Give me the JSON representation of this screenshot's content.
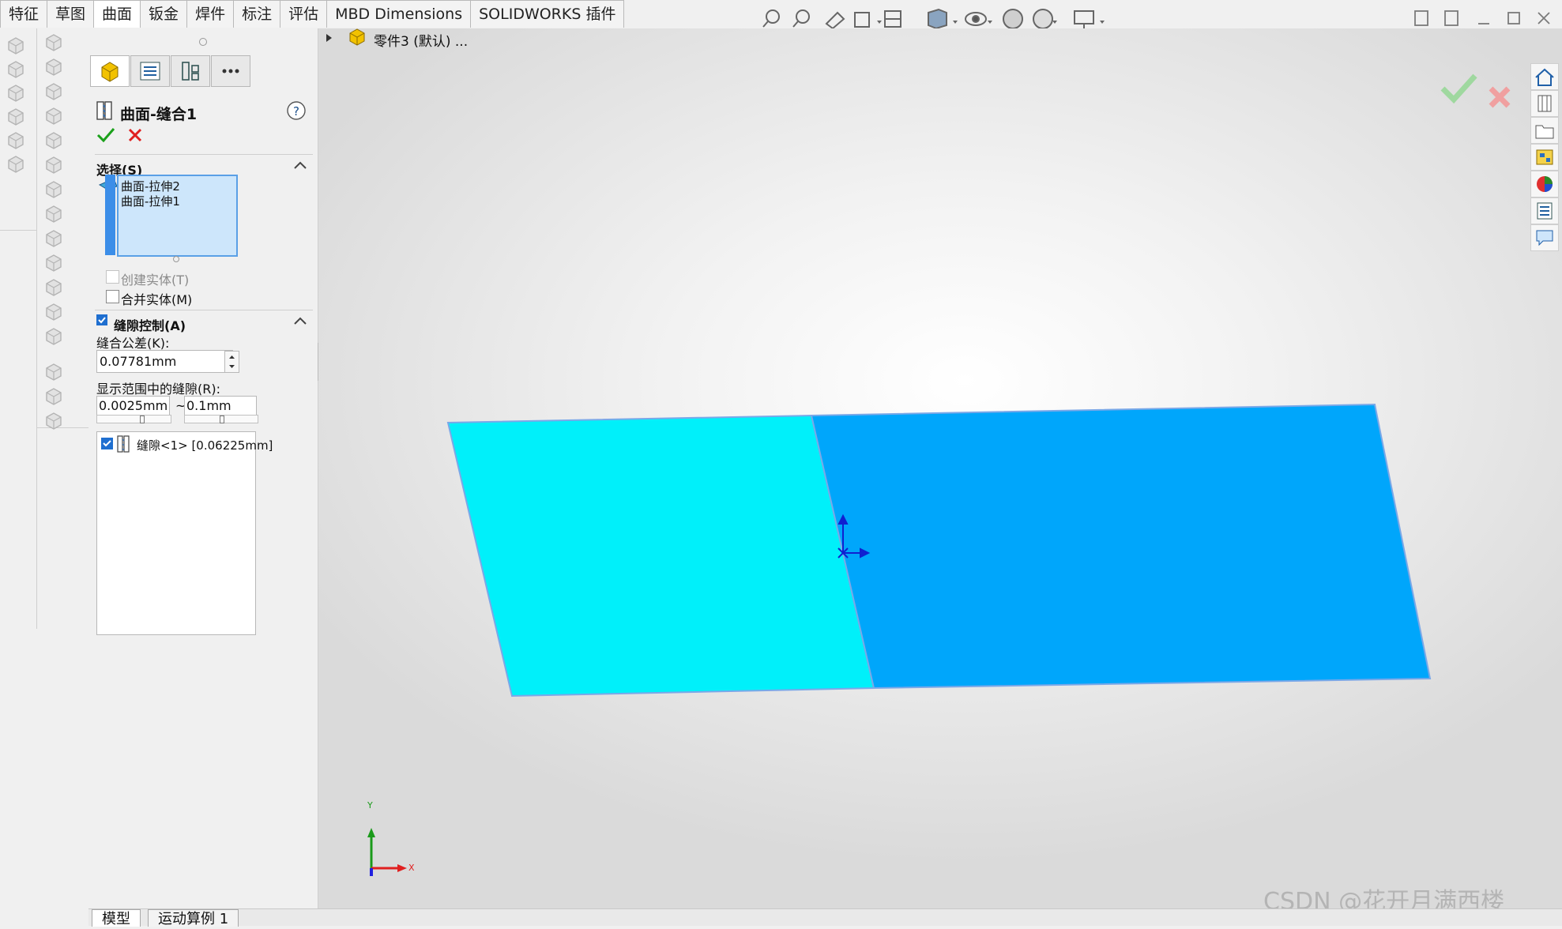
{
  "tabs": [
    "特征",
    "草图",
    "曲面",
    "钣金",
    "焊件",
    "标注",
    "评估",
    "MBD Dimensions",
    "SOLIDWORKS 插件"
  ],
  "active_tab_index": 2,
  "tree": {
    "part_label": "零件3 (默认) ..."
  },
  "property_manager": {
    "title": "曲面-缝合1",
    "selection": {
      "header": "选择(S)",
      "items": [
        "曲面-拉伸2",
        "曲面-拉伸1"
      ],
      "create_solid": {
        "label": "创建实体(T)",
        "checked": false,
        "enabled": false
      },
      "merge_entities": {
        "label": "合并实体(M)",
        "checked": false,
        "enabled": true
      }
    },
    "gap_control": {
      "header": "缝隙控制(A)",
      "checked": true,
      "tolerance_label": "缝合公差(K):",
      "tolerance_value": "0.07781mm",
      "range_label": "显示范围中的缝隙(R):",
      "range_min": "0.0025mm",
      "range_sep": "~",
      "range_max": "0.1mm",
      "gaps": [
        {
          "label": "缝隙<1> [0.06225mm]",
          "checked": true
        }
      ]
    }
  },
  "bottom_tabs": [
    "模型",
    "运动算例 1"
  ],
  "triad": {
    "x": "X",
    "y": "Y"
  },
  "watermark": "CSDN @花开月满西楼",
  "colors": {
    "surface_left": "#00f0fa",
    "surface_right": "#00a6fb",
    "accent": "#1f6fd0",
    "ok": "#1aa01a",
    "cancel": "#e02020"
  }
}
